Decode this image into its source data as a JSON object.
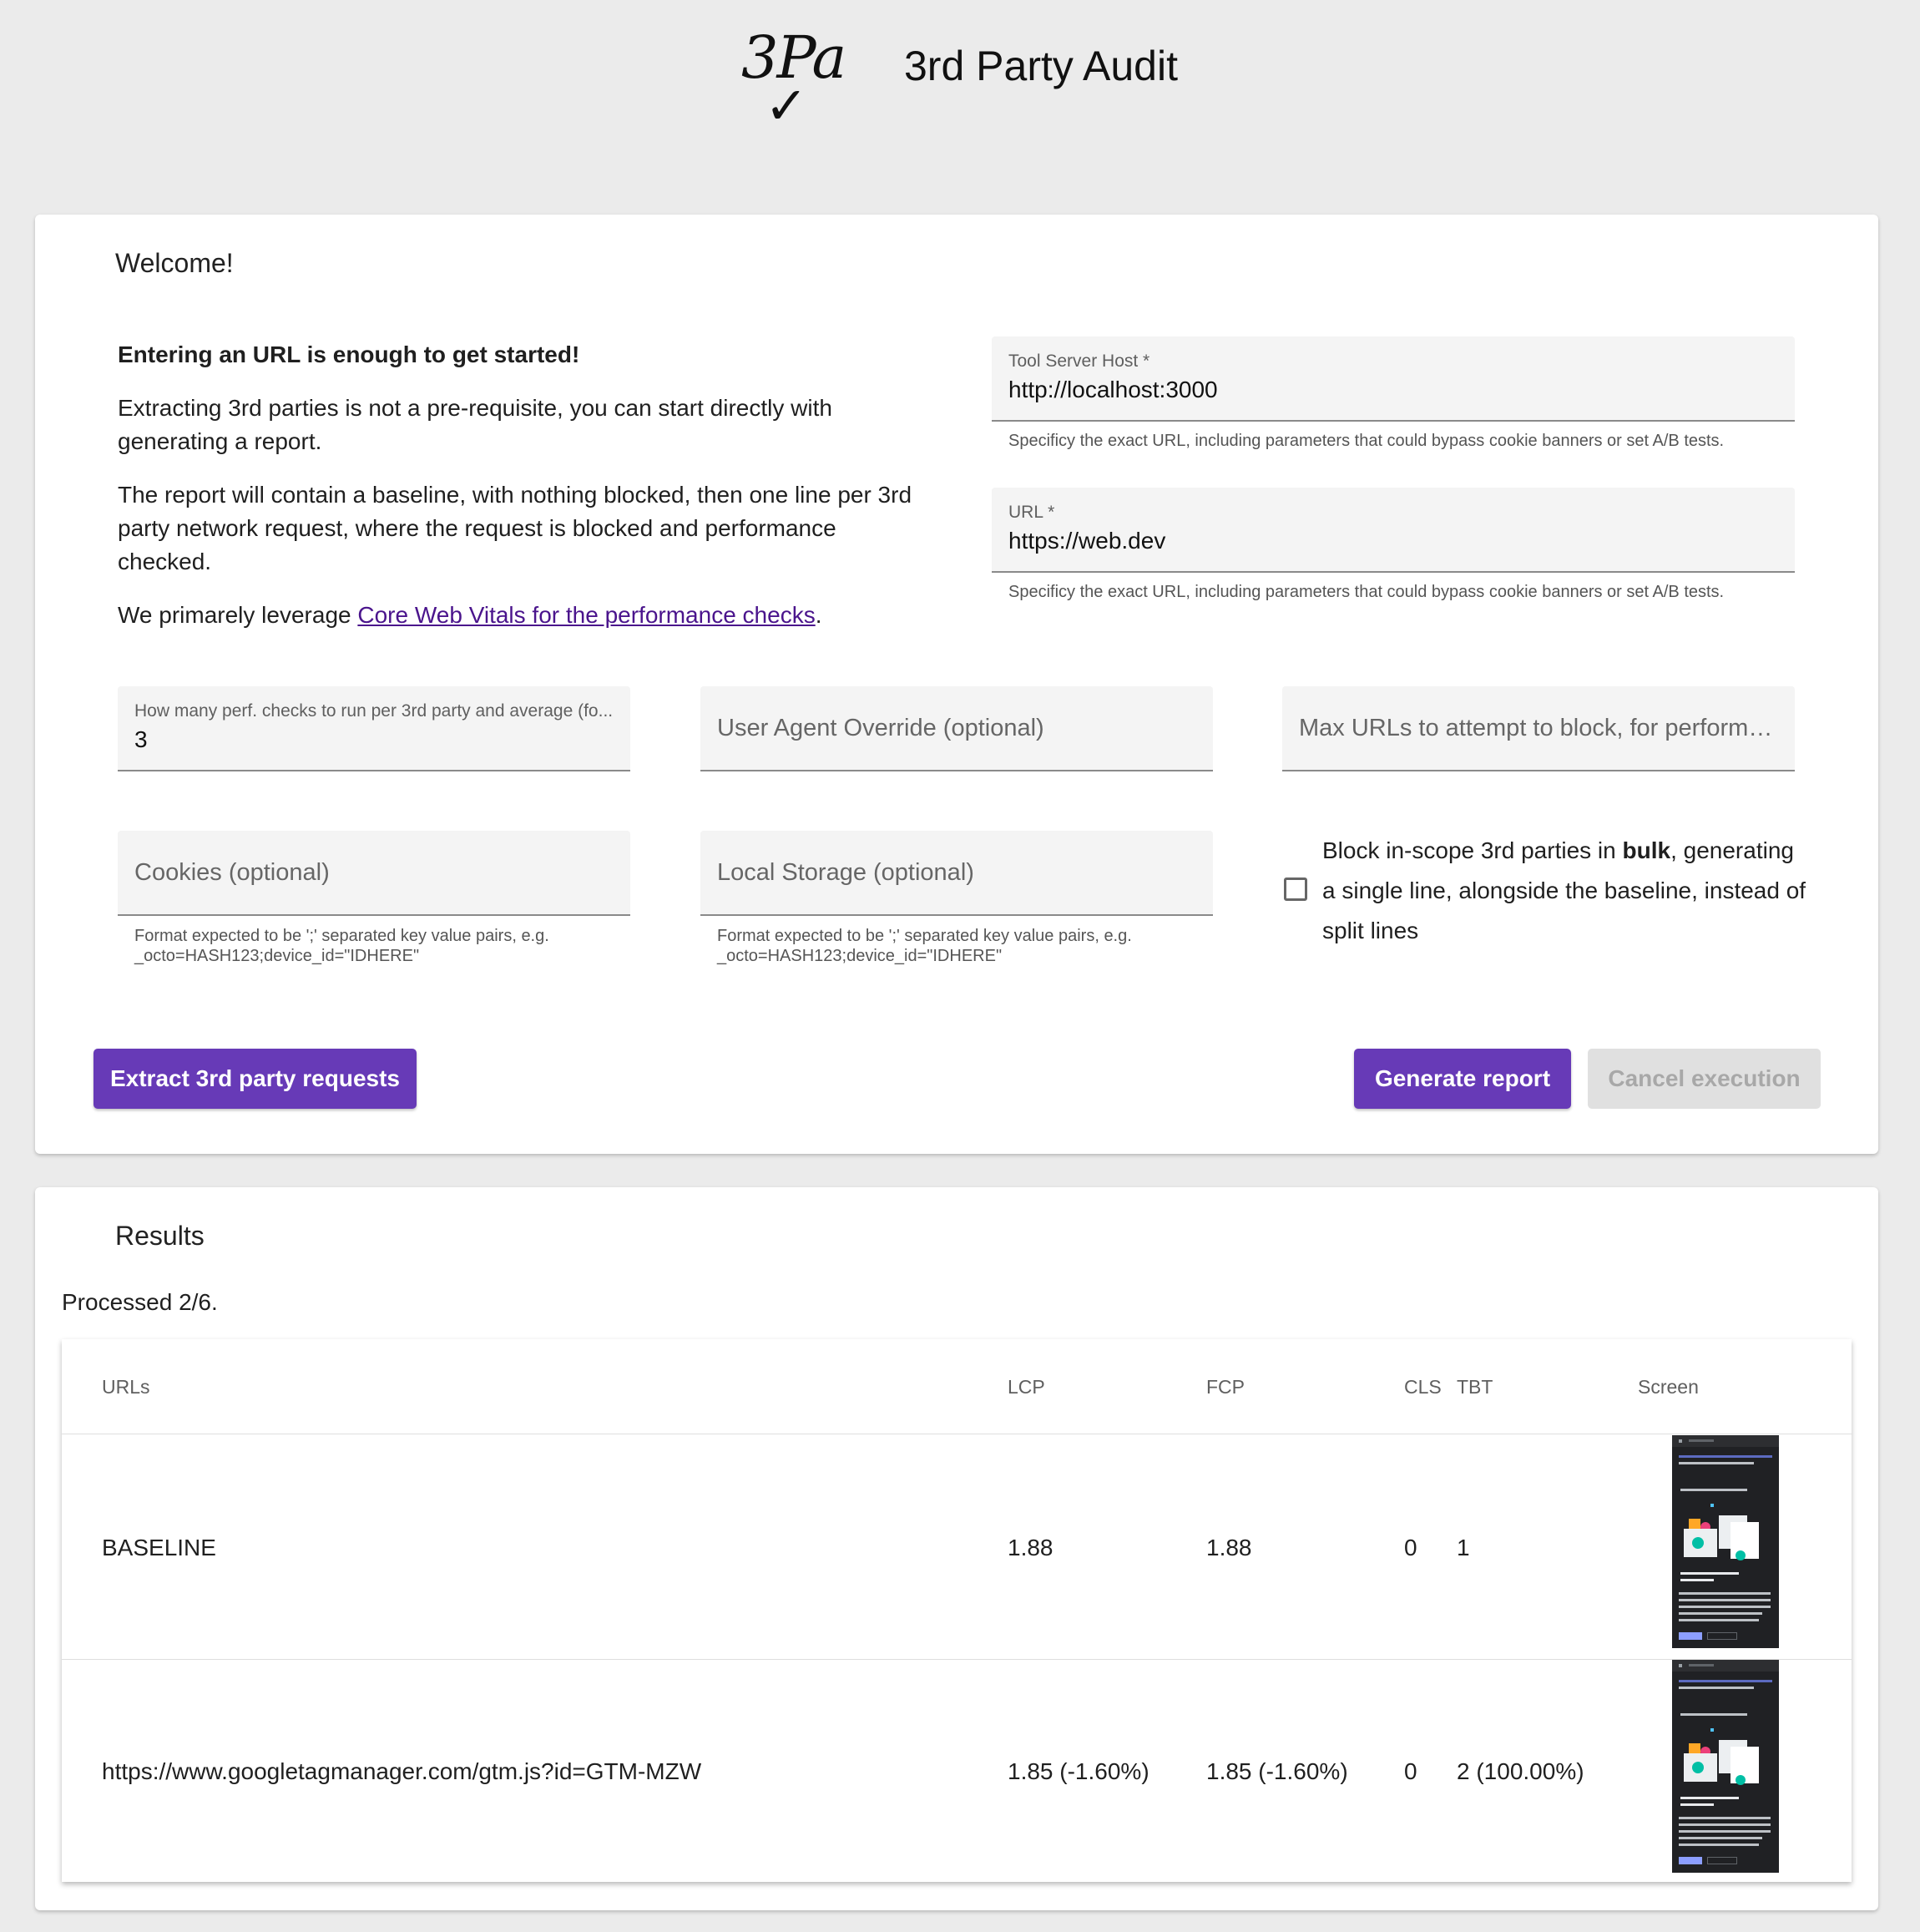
{
  "header": {
    "logo_text": "3Pa",
    "logo_mark": "✓",
    "title": "3rd Party Audit"
  },
  "setup": {
    "title": "Welcome!",
    "intro": {
      "heading": "Entering an URL is enough to get started!",
      "paragraph1": "Extracting 3rd parties is not a pre-requisite, you can start directly with generating a report.",
      "paragraph2": "The report will contain a baseline, with nothing blocked, then one line per 3rd party network request, where the request is blocked and performance checked.",
      "paragraph3_prefix": "We primarely leverage ",
      "paragraph3_link": "Core Web Vitals for the performance checks",
      "paragraph3_suffix": "."
    },
    "fields": {
      "tool_server_host": {
        "label": "Tool Server Host *",
        "value": "http://localhost:3000",
        "hint": "Specificy the exact URL, including parameters that could bypass cookie banners or set A/B tests."
      },
      "url": {
        "label": "URL *",
        "value": "https://web.dev",
        "hint": "Specificy the exact URL, including parameters that could bypass cookie banners or set A/B tests."
      },
      "perf_checks": {
        "label": "How many perf. checks to run per 3rd party and average (fo...",
        "value": "3"
      },
      "user_agent": {
        "placeholder": "User Agent Override (optional)"
      },
      "max_urls": {
        "placeholder": "Max URLs to attempt to block, for performan..."
      },
      "cookies": {
        "placeholder": "Cookies (optional)",
        "hint_line1": "Format expected to be ';' separated key value pairs, e.g.",
        "hint_line2": "_octo=HASH123;device_id=\"IDHERE\""
      },
      "local_storage": {
        "placeholder": "Local Storage (optional)",
        "hint_line1": "Format expected to be ';' separated key value pairs, e.g.",
        "hint_line2": "_octo=HASH123;device_id=\"IDHERE\""
      }
    },
    "bulk_checkbox": {
      "checked": false,
      "label_prefix": "Block in-scope 3rd parties in ",
      "label_bold": "bulk",
      "label_suffix": ", generating a single line, alongside the baseline, instead of split lines"
    },
    "buttons": {
      "extract": "Extract 3rd party requests",
      "generate": "Generate report",
      "cancel": "Cancel execution"
    },
    "colors": {
      "primary": "#673ab7",
      "link": "#4a148c",
      "disabled_bg": "#e0e0e0"
    }
  },
  "results": {
    "title": "Results",
    "status": "Processed 2/6.",
    "columns": [
      "URLs",
      "LCP",
      "FCP",
      "CLS",
      "TBT",
      "Screen"
    ],
    "rows": [
      {
        "url": "BASELINE",
        "lcp": "1.88",
        "fcp": "1.88",
        "cls": "0",
        "tbt": "1"
      },
      {
        "url": "https://www.googletagmanager.com/gtm.js?id=GTM-MZW",
        "lcp": "1.85 (-1.60%)",
        "fcp": "1.85 (-1.60%)",
        "cls": "0",
        "tbt": "2 (100.00%)"
      }
    ]
  }
}
